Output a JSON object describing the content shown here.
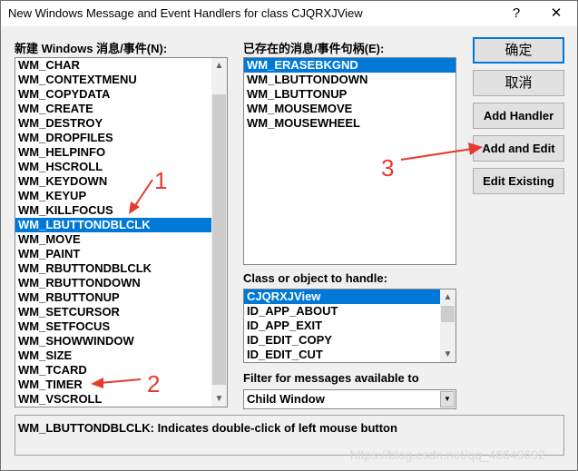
{
  "window": {
    "title": "New Windows Message and Event Handlers for class CJQRXJView",
    "help": "?",
    "close": "✕"
  },
  "new_messages": {
    "label": "新建 Windows 消息/事件(N):",
    "items": [
      "WM_CHAR",
      "WM_CONTEXTMENU",
      "WM_COPYDATA",
      "WM_CREATE",
      "WM_DESTROY",
      "WM_DROPFILES",
      "WM_HELPINFO",
      "WM_HSCROLL",
      "WM_KEYDOWN",
      "WM_KEYUP",
      "WM_KILLFOCUS",
      "WM_LBUTTONDBLCLK",
      "WM_MOVE",
      "WM_PAINT",
      "WM_RBUTTONDBLCLK",
      "WM_RBUTTONDOWN",
      "WM_RBUTTONUP",
      "WM_SETCURSOR",
      "WM_SETFOCUS",
      "WM_SHOWWINDOW",
      "WM_SIZE",
      "WM_TCARD",
      "WM_TIMER",
      "WM_VSCROLL"
    ],
    "selected": "WM_LBUTTONDBLCLK"
  },
  "existing": {
    "label": "已存在的消息/事件句柄(E):",
    "items": [
      "WM_ERASEBKGND",
      "WM_LBUTTONDOWN",
      "WM_LBUTTONUP",
      "WM_MOUSEMOVE",
      "WM_MOUSEWHEEL"
    ],
    "selected": "WM_ERASEBKGND"
  },
  "buttons": {
    "ok": "确定",
    "cancel": "取消",
    "add_handler": "Add Handler",
    "add_and_edit": "Add and Edit",
    "edit_existing": "Edit Existing"
  },
  "class_list": {
    "label": "Class or object to handle:",
    "items": [
      "CJQRXJView",
      "ID_APP_ABOUT",
      "ID_APP_EXIT",
      "ID_EDIT_COPY",
      "ID_EDIT_CUT"
    ],
    "selected": "CJQRXJView"
  },
  "filter": {
    "label": "Filter for messages available to",
    "value": "Child Window"
  },
  "status": "WM_LBUTTONDBLCLK:  Indicates double-click of left mouse button",
  "watermark": "https://blog.csdn.net/qq_46649692",
  "annotations": [
    "1",
    "2",
    "3"
  ],
  "colors": {
    "selection": "#0078d7",
    "annotation": "#e8392f"
  }
}
